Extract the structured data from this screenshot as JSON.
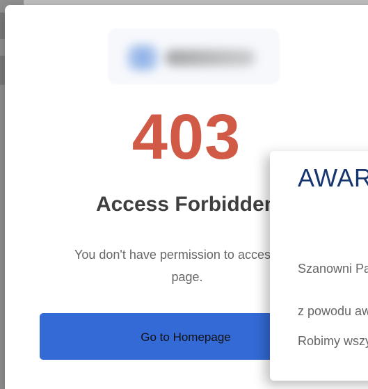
{
  "error_page": {
    "code": "403",
    "title": "Access Forbidden",
    "message_line1": "You don't have permission to access this",
    "message_line2": "page.",
    "home_button_label": "Go to Homepage",
    "logo_icon": "blurred-logo-icon",
    "accent_color": "#d05a45",
    "button_color": "#336ad6"
  },
  "award_dialog": {
    "title": "AWARIA",
    "line1": "Szanowni Państwo,",
    "line2": "z powodu awarii",
    "line3": "Robimy wszystko"
  }
}
